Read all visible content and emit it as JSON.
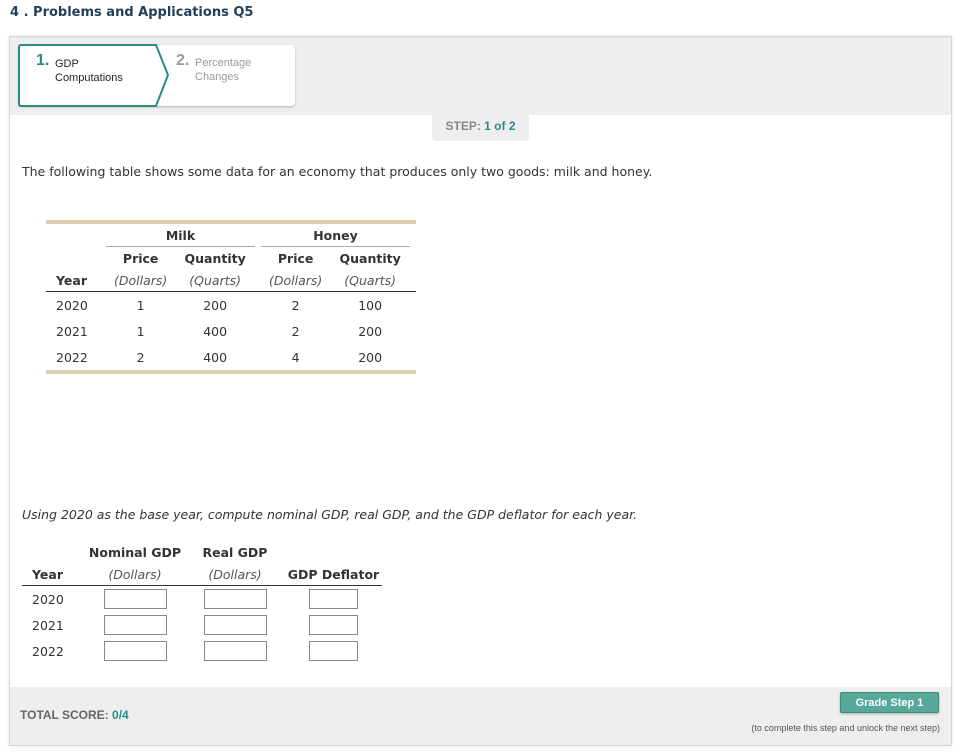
{
  "page_title": "4 . Problems and Applications Q5",
  "tabs": [
    {
      "num": "1.",
      "label_line1": "GDP",
      "label_line2": "Computations",
      "active": true
    },
    {
      "num": "2.",
      "label_line1": "Percentage",
      "label_line2": "Changes",
      "active": false
    }
  ],
  "step_indicator": {
    "label": "STEP:",
    "value": "1 of 2"
  },
  "intro_text": "The following table shows some data for an economy that produces only two goods: milk and honey.",
  "data_table": {
    "groups": [
      "Milk",
      "Honey"
    ],
    "columns": [
      "Price",
      "Quantity",
      "Price",
      "Quantity"
    ],
    "units": [
      "(Dollars)",
      "(Quarts)",
      "(Dollars)",
      "(Quarts)"
    ],
    "year_header": "Year",
    "rows": [
      {
        "year": "2020",
        "milk_price": "1",
        "milk_qty": "200",
        "honey_price": "2",
        "honey_qty": "100"
      },
      {
        "year": "2021",
        "milk_price": "1",
        "milk_qty": "400",
        "honey_price": "2",
        "honey_qty": "200"
      },
      {
        "year": "2022",
        "milk_price": "2",
        "milk_qty": "400",
        "honey_price": "4",
        "honey_qty": "200"
      }
    ]
  },
  "instruction_text": "Using 2020 as the base year, compute nominal GDP, real GDP, and the GDP deflator for each year.",
  "answer_table": {
    "year_header": "Year",
    "col1": "Nominal GDP",
    "col1_unit": "(Dollars)",
    "col2": "Real GDP",
    "col2_unit": "(Dollars)",
    "col3": "GDP Deflator",
    "years": [
      "2020",
      "2021",
      "2022"
    ],
    "values": {
      "nominal": [
        "",
        "",
        ""
      ],
      "real": [
        "",
        "",
        ""
      ],
      "deflator": [
        "",
        "",
        ""
      ]
    }
  },
  "footer": {
    "total_label": "TOTAL SCORE:",
    "total_value": "0/4",
    "grade_button": "Grade Step 1",
    "grade_note": "(to complete this step and unlock the next step)"
  },
  "colors": {
    "accent": "#2a8a86",
    "title": "#1f3f5c",
    "table_rule": "#dccdb0",
    "button": "#56a89a",
    "panel_bg": "#eeeeee"
  }
}
